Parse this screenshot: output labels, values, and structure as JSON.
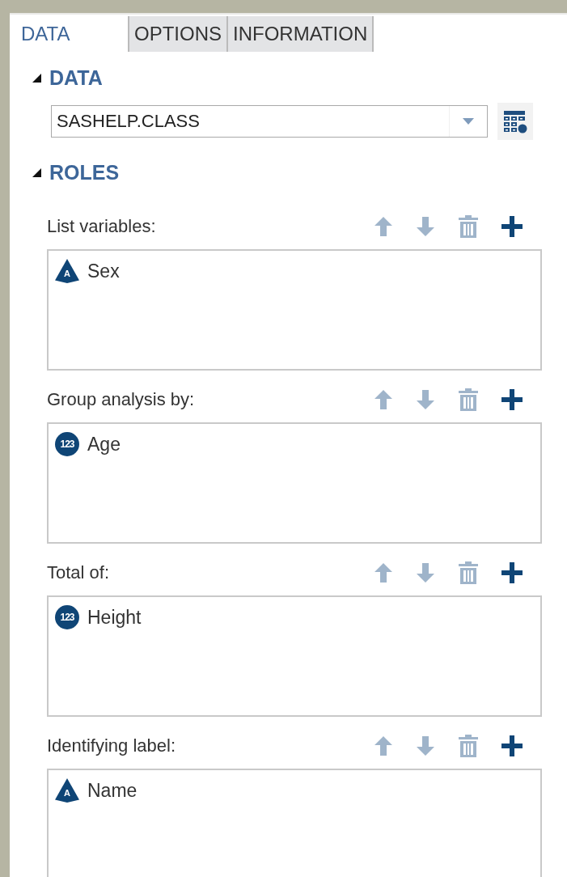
{
  "tabs": [
    {
      "label": "DATA",
      "selected": true
    },
    {
      "label": "OPTIONS",
      "selected": false
    },
    {
      "label": "INFORMATION",
      "selected": false
    }
  ],
  "data_section": {
    "title": "DATA",
    "expanded": true,
    "dataset": "SASHELP.CLASS"
  },
  "roles_section": {
    "title": "ROLES",
    "expanded": true,
    "roles": [
      {
        "label": "List variables:",
        "move_up_disabled": true,
        "move_down_disabled": true,
        "delete_disabled": true,
        "add_disabled": false,
        "variables": [
          {
            "kind": "character",
            "badge": "A",
            "name": "Sex"
          }
        ]
      },
      {
        "label": "Group analysis by:",
        "move_up_disabled": true,
        "move_down_disabled": true,
        "delete_disabled": true,
        "add_disabled": false,
        "variables": [
          {
            "kind": "numeric",
            "badge": "123",
            "name": "Age"
          }
        ]
      },
      {
        "label": "Total of:",
        "move_up_disabled": true,
        "move_down_disabled": true,
        "delete_disabled": true,
        "add_disabled": false,
        "variables": [
          {
            "kind": "numeric",
            "badge": "123",
            "name": "Height"
          }
        ]
      },
      {
        "label": "Identifying label:",
        "move_up_disabled": true,
        "move_down_disabled": true,
        "delete_disabled": true,
        "add_disabled": false,
        "variables": [
          {
            "kind": "character",
            "badge": "A",
            "name": "Name"
          }
        ]
      }
    ]
  }
}
